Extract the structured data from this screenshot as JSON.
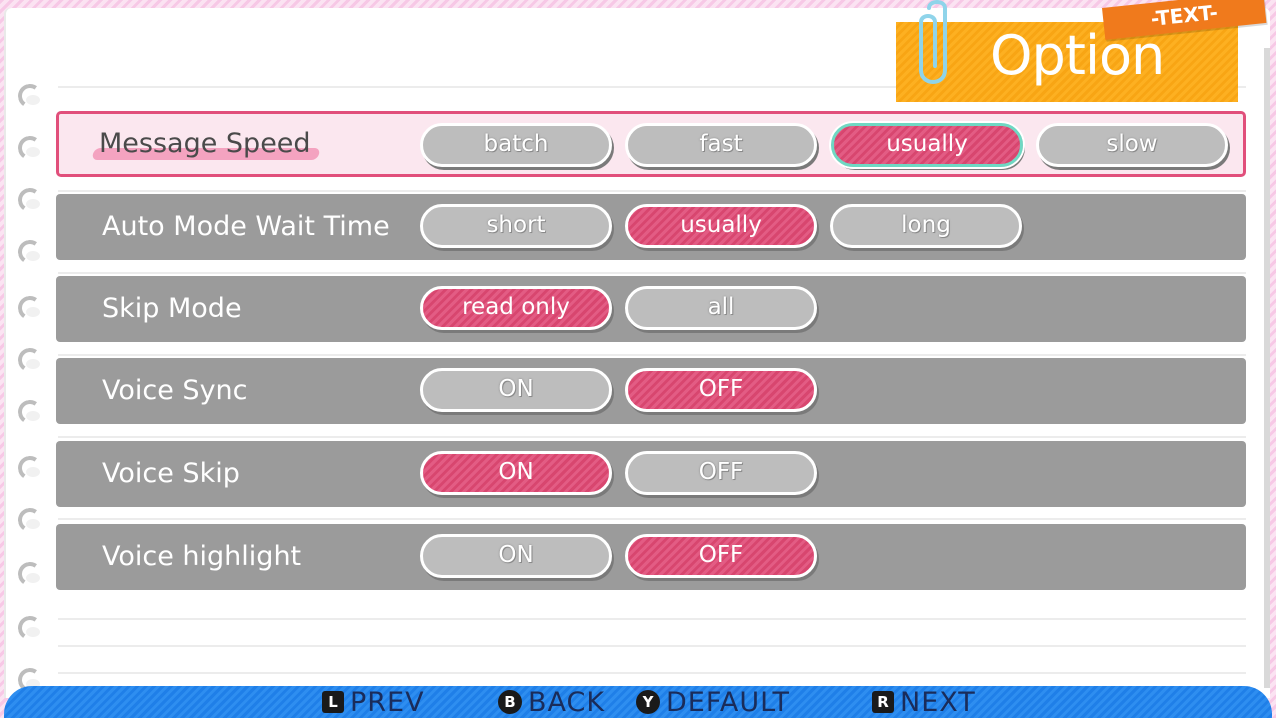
{
  "header": {
    "title": "Option",
    "tag": "-TEXT-"
  },
  "settings": [
    {
      "label": "Message Speed",
      "options": [
        "batch",
        "fast",
        "usually",
        "slow"
      ],
      "selected": "usually"
    },
    {
      "label": "Auto Mode Wait Time",
      "options": [
        "short",
        "usually",
        "long"
      ],
      "selected": "usually"
    },
    {
      "label": "Skip Mode",
      "options": [
        "read only",
        "all"
      ],
      "selected": "read only"
    },
    {
      "label": "Voice Sync",
      "options": [
        "ON",
        "OFF"
      ],
      "selected": "OFF"
    },
    {
      "label": "Voice Skip",
      "options": [
        "ON",
        "OFF"
      ],
      "selected": "ON"
    },
    {
      "label": "Voice highlight",
      "options": [
        "ON",
        "OFF"
      ],
      "selected": "OFF"
    }
  ],
  "footer": {
    "prev": {
      "key": "L",
      "label": "PREV"
    },
    "back": {
      "key": "B",
      "label": "BACK"
    },
    "default": {
      "key": "Y",
      "label": "DEFAULT"
    },
    "next": {
      "key": "R",
      "label": "NEXT"
    }
  },
  "colors": {
    "selected": "#e35c84",
    "unselected": "#bdbdbd",
    "row_bg": "#9b9b9b",
    "focus_outline": "#6fd8c3",
    "title_plate": "#fdb021",
    "tag": "#f07a1c",
    "footer": "#2e8ef0"
  }
}
